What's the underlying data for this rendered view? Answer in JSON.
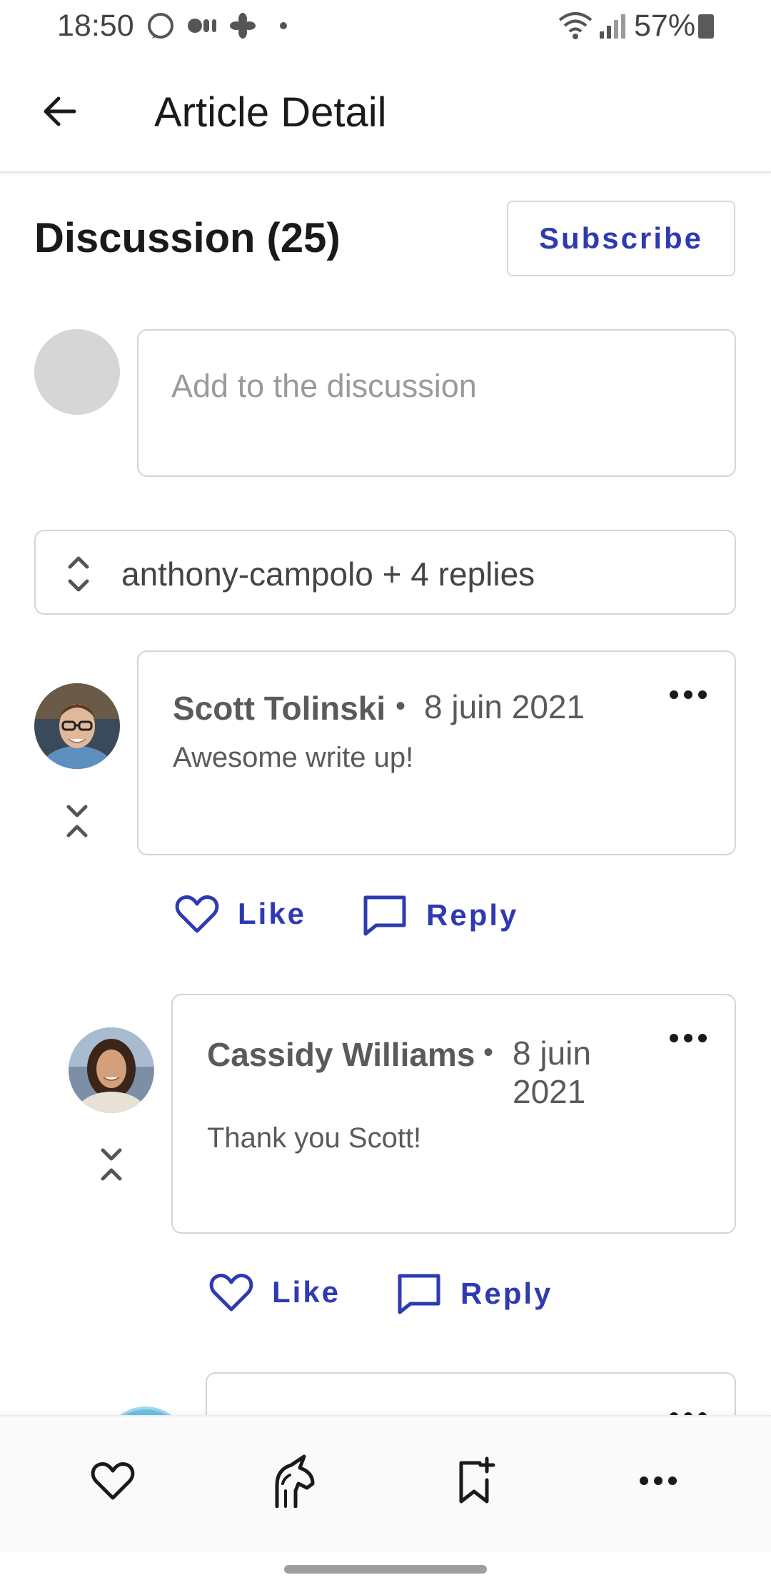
{
  "status_bar": {
    "time": "18:50",
    "battery": "57%"
  },
  "header": {
    "title": "Article Detail"
  },
  "discussion": {
    "title": "Discussion (25)",
    "subscribe_label": "Subscribe",
    "compose_placeholder": "Add to the discussion"
  },
  "thread": {
    "toggle_label": "anthony-campolo + 4 replies"
  },
  "comments": [
    {
      "author": "Scott Tolinski",
      "date": "8 juin 2021",
      "text": "Awesome write up!",
      "like_label": "Like",
      "reply_label": "Reply"
    },
    {
      "author": "Cassidy Williams",
      "date_line1": "8 juin",
      "date_line2": "2021",
      "text": "Thank you Scott!",
      "like_label": "Like",
      "reply_label": "Reply"
    }
  ],
  "bottom_bar": {
    "items": [
      "heart-icon",
      "unicorn-icon",
      "bookmark-add-icon",
      "more-icon"
    ]
  },
  "colors": {
    "accent": "#2f3ab2",
    "border": "#d4d4d4",
    "text_muted": "#5a5a5a"
  }
}
